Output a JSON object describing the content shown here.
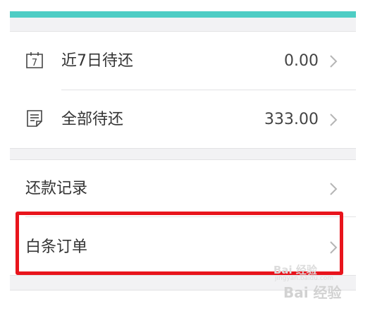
{
  "colors": {
    "accent_bar": "#4ecdc4",
    "highlight": "#e8141c"
  },
  "repay_summary": {
    "items": [
      {
        "icon": "calendar-7-icon",
        "calendar_day": "7",
        "label": "近7日待还",
        "amount": "0.00"
      },
      {
        "icon": "document-list-icon",
        "label": "全部待还",
        "amount": "333.00"
      }
    ]
  },
  "links": {
    "items": [
      {
        "label": "还款记录"
      },
      {
        "label": "白条订单"
      }
    ]
  },
  "watermark": {
    "line1": "Bai 经验",
    "line1_sub": "jingyan.baidu.com",
    "line2": "Bai 经验"
  }
}
